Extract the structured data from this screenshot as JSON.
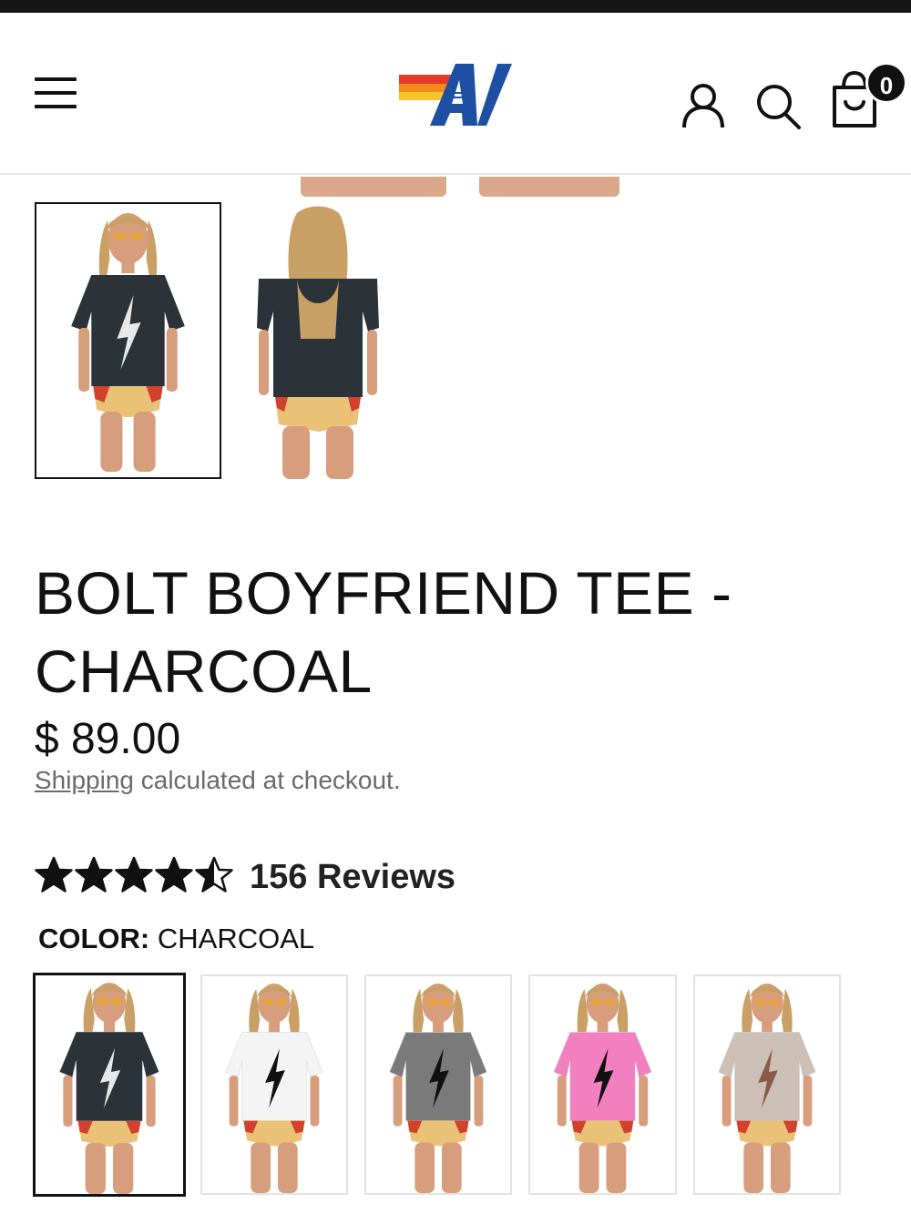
{
  "header": {
    "menu_icon": "hamburger-menu-icon",
    "logo_icon": "aviator-nation-av-logo",
    "account_icon": "user-account-icon",
    "search_icon": "search-icon",
    "cart_icon": "shopping-bag-icon",
    "cart_count": "0"
  },
  "gallery": {
    "thumbnails": [
      {
        "view": "front",
        "selected": true
      },
      {
        "view": "back",
        "selected": false
      }
    ]
  },
  "product": {
    "title_line1": "BOLT BOYFRIEND TEE -",
    "title_line2": "CHARCOAL",
    "price": "$ 89.00",
    "shipping_link": "Shipping",
    "shipping_text": " calculated at checkout.",
    "rating": 4.5,
    "rating_max": 5,
    "reviews_label": "156 Reviews",
    "color_label": "COLOR:",
    "color_value": "CHARCOAL"
  },
  "swatches": [
    {
      "color": "#2b3238",
      "bolt": "#e8e8e8",
      "selected": true
    },
    {
      "color": "#f4f4f4",
      "bolt": "#111111",
      "selected": false
    },
    {
      "color": "#7a7a7a",
      "bolt": "#111111",
      "selected": false
    },
    {
      "color": "#f27fc0",
      "bolt": "#111111",
      "selected": false
    },
    {
      "color": "#cbbfb6",
      "bolt": "#8a5a48",
      "selected": false
    }
  ],
  "colors": {
    "text": "#111111",
    "muted": "#6a6a6a",
    "logo_blue": "#1f4fa3",
    "logo_red": "#e23a2b",
    "logo_orange": "#f28a1e",
    "logo_yellow": "#f7c52a"
  }
}
